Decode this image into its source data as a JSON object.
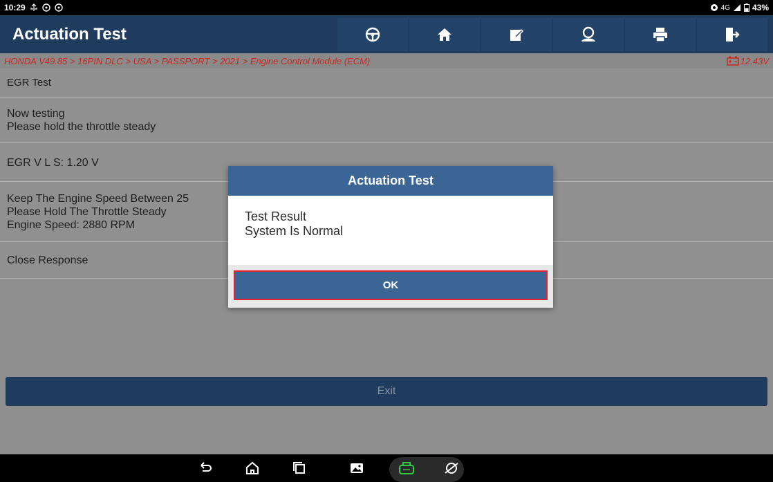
{
  "status_bar": {
    "time": "10:29",
    "network": "4G",
    "battery": "43%"
  },
  "header": {
    "title": "Actuation Test",
    "tools": [
      {
        "icon": "steering-wheel-icon"
      },
      {
        "icon": "home-icon"
      },
      {
        "icon": "edit-icon"
      },
      {
        "icon": "user-icon"
      },
      {
        "icon": "printer-icon"
      },
      {
        "icon": "exit-door-icon"
      }
    ]
  },
  "breadcrumb": {
    "path": "HONDA V49.85 > 16PIN DLC > USA > PASSPORT > 2021 > Engine Control Module (ECM)",
    "voltage": "12.43V"
  },
  "rows": {
    "egr_test": "EGR Test",
    "now_testing_1": "Now testing",
    "now_testing_2": "Please hold the throttle steady",
    "egr_vls": "EGR V L S: 1.20 V",
    "keep_speed_1": "Keep The Engine Speed Between 25",
    "keep_speed_2": "Please Hold The Throttle Steady",
    "keep_speed_3": "Engine Speed: 2880 RPM",
    "close_response": "Close Response"
  },
  "exit_label": "Exit",
  "dialog": {
    "title": "Actuation Test",
    "line1": "Test Result",
    "line2": "System Is Normal",
    "ok_label": "OK"
  },
  "colors": {
    "header_bg": "#1f3b5e",
    "dialog_header": "#3a6594",
    "breadcrumb_text": "#c8281e",
    "highlight_border": "#e8212e"
  }
}
